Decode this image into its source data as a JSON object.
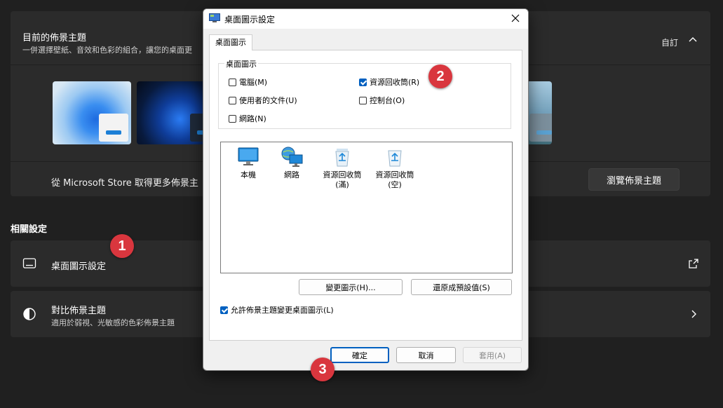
{
  "theme": {
    "title": "目前的佈景主題",
    "subtitle": "一併選擇壁紙、音效和色彩的組合，讓您的桌面更",
    "current": "自訂",
    "store_text": "從 Microsoft Store 取得更多佈景主",
    "browse_label": "瀏覽佈景主題"
  },
  "related": {
    "section_title": "相關設定",
    "desktop_icons": "桌面圖示設定",
    "contrast_title": "對比佈景主題",
    "contrast_sub": "適用於弱視、光敏感的色彩佈景主題"
  },
  "badges": [
    "1",
    "2",
    "3"
  ],
  "dialog": {
    "title": "桌面圖示設定",
    "tab": "桌面圖示",
    "group_legend": "桌面圖示",
    "checkboxes": [
      {
        "label": "電腦(M)",
        "checked": false
      },
      {
        "label": "資源回收筒(R)",
        "checked": true
      },
      {
        "label": "使用者的文件(U)",
        "checked": false
      },
      {
        "label": "控制台(O)",
        "checked": false
      },
      {
        "label": "網路(N)",
        "checked": false
      }
    ],
    "icons": [
      {
        "label": "本機",
        "icon": "monitor-icon"
      },
      {
        "label": "網路",
        "icon": "network-icon"
      },
      {
        "label": "資源回收筒 (滿)",
        "icon": "recycle-bin-full-icon"
      },
      {
        "label": "資源回收筒 (空)",
        "icon": "recycle-bin-empty-icon"
      }
    ],
    "change_icon": "變更圖示(H)...",
    "restore_default": "還原成預設值(S)",
    "allow_themes": "允許佈景主題變更桌面圖示(L)",
    "ok": "確定",
    "cancel": "取消",
    "apply": "套用(A)"
  },
  "colors": {
    "accent": "#0060c0",
    "badge": "#d9363e",
    "background": "#202020",
    "card": "#2b2b2b"
  }
}
